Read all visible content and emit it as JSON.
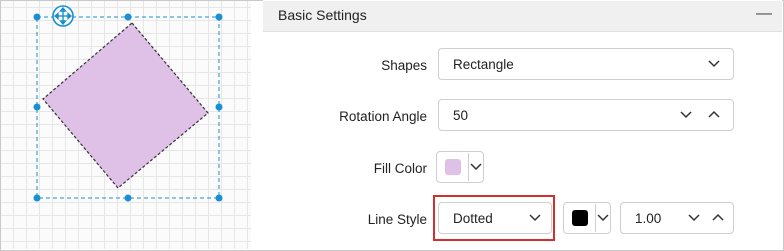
{
  "panel": {
    "title": "Basic Settings",
    "collapse_icon": "minus-icon"
  },
  "canvas": {
    "shape": "diamond",
    "fill_color": "#dfc0e7",
    "stroke_color": "#333333",
    "selection_color": "#1a8fd1",
    "move_handle_icon": "move-arrows-icon"
  },
  "form": {
    "shapes": {
      "label": "Shapes",
      "value": "Rectangle"
    },
    "rotation": {
      "label": "Rotation Angle",
      "value": "50"
    },
    "fill": {
      "label": "Fill Color",
      "color": "#dfc0e7"
    },
    "line_style": {
      "label": "Line Style",
      "value": "Dotted",
      "stroke_color": "#000000",
      "width_value": "1.00"
    }
  },
  "colors": {
    "highlight": "#d32f2f",
    "accent": "#1a8fd1"
  }
}
